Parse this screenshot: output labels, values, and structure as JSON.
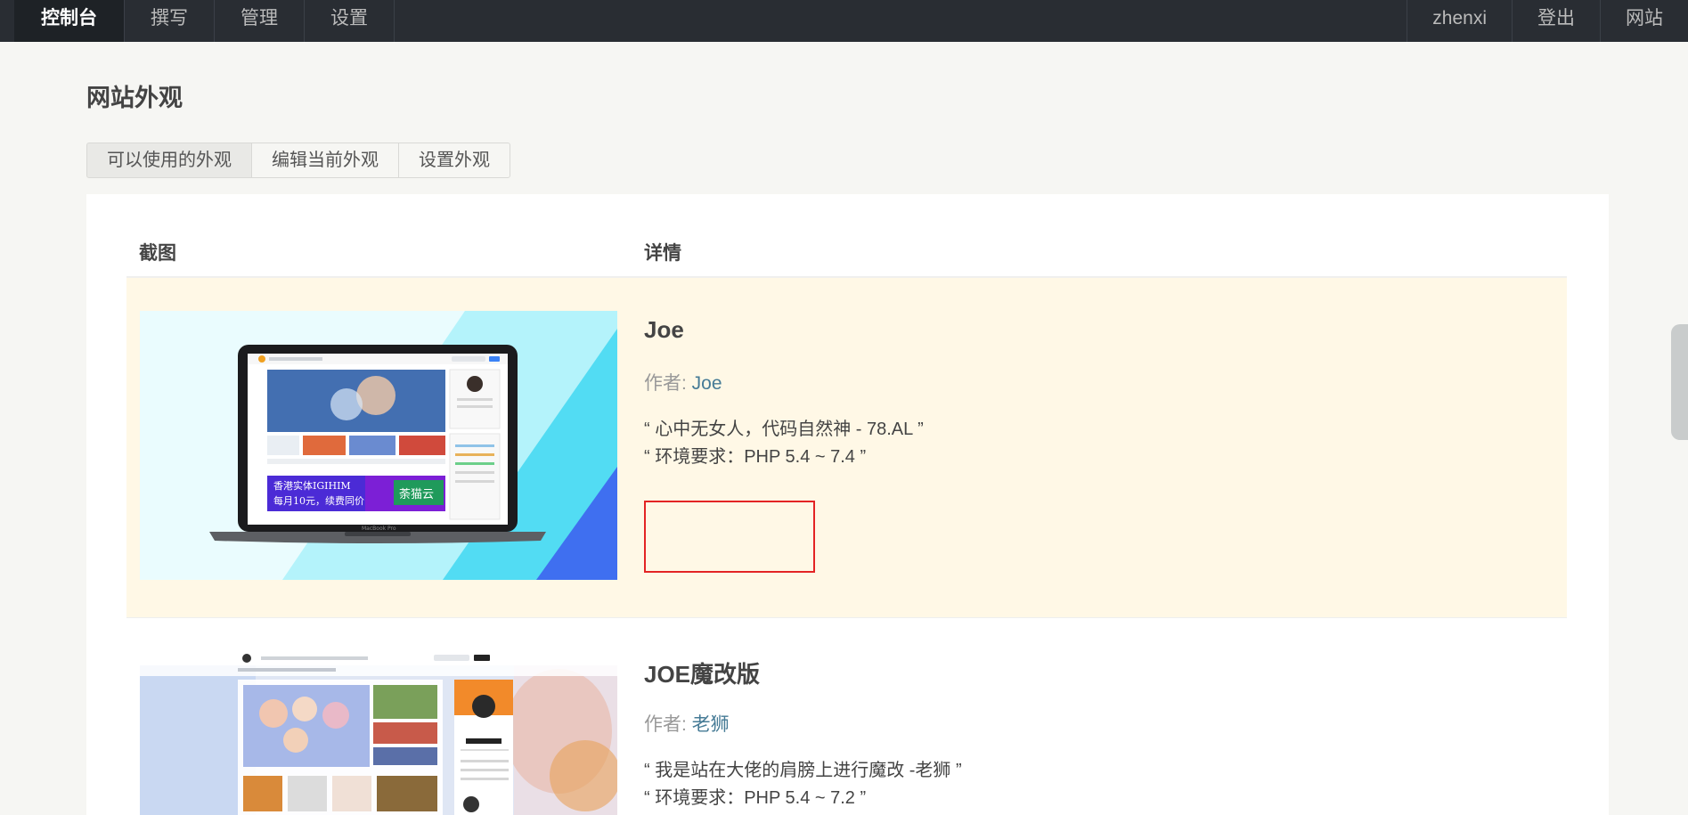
{
  "nav": {
    "left": [
      "控制台",
      "撰写",
      "管理",
      "设置"
    ],
    "right": [
      "zhenxi",
      "登出",
      "网站"
    ]
  },
  "page_title": "网站外观",
  "tabs": [
    "可以使用的外观",
    "编辑当前外观",
    "设置外观"
  ],
  "table": {
    "col_screenshot": "截图",
    "col_details": "详情"
  },
  "themes": [
    {
      "name": "Joe",
      "author_label": "作者: ",
      "author": "Joe",
      "desc1": "“ 心中无女人，代码自然神 - 78.AL ”",
      "desc2": "“ 环境要求：PHP 5.4 ~ 7.4 ”",
      "ad_line1": "香港实体IGIHIM",
      "ad_line2": "每月10元，续费同价",
      "ad_brand": "荼猫云",
      "laptop_label": "MacBook Pro"
    },
    {
      "name": "JOE魔改版",
      "author_label": "作者: ",
      "author": "老狮",
      "desc1": "“ 我是站在大佬的肩膀上进行魔改 -老狮 ”",
      "desc2": "“ 环境要求：PHP 5.4 ~ 7.2 ”"
    }
  ],
  "colors": {
    "topbar": "#292d33",
    "current_row": "#fff8e6",
    "link": "#467b96",
    "highlight_border": "#e32424"
  }
}
